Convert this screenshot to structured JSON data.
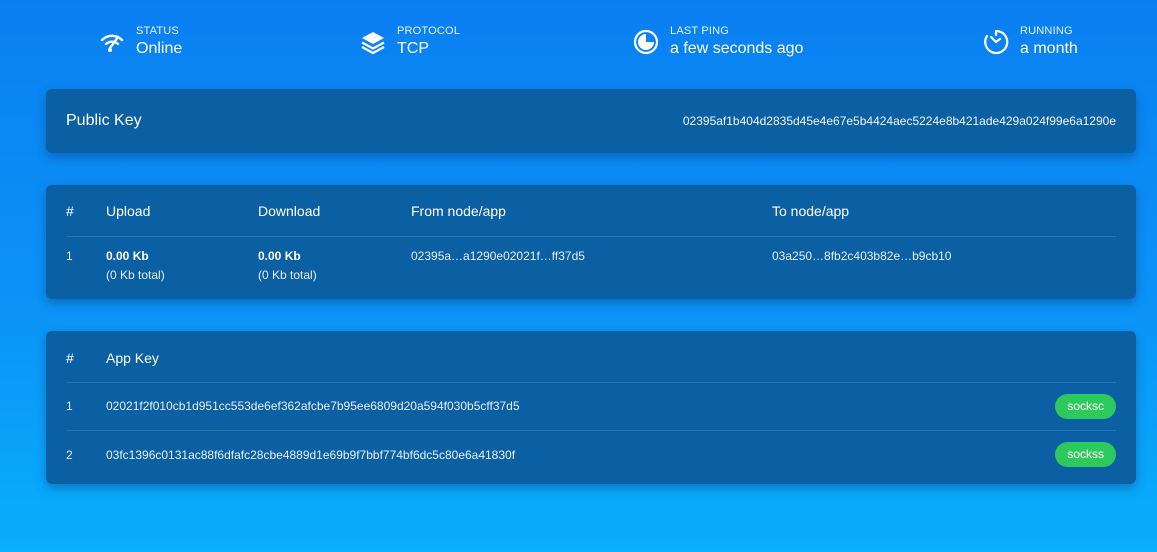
{
  "stats": [
    {
      "label": "STATUS",
      "value": "Online",
      "icon": "wifi-signal-icon"
    },
    {
      "label": "PROTOCOL",
      "value": "TCP",
      "icon": "layers-icon"
    },
    {
      "label": "LAST PING",
      "value": "a few seconds ago",
      "icon": "moon-clock-icon"
    },
    {
      "label": "RUNNING",
      "value": "a month",
      "icon": "timer-icon"
    }
  ],
  "public_key": {
    "label": "Public Key",
    "value": "02395af1b404d2835d45e4e67e5b4424aec5224e8b421ade429a024f99e6a1290e"
  },
  "transports": {
    "headers": [
      "#",
      "Upload",
      "Download",
      "From node/app",
      "To node/app"
    ],
    "rows": [
      {
        "index": "1",
        "upload": "0.00 Kb",
        "upload_total": "(0 Kb total)",
        "download": "0.00 Kb",
        "download_total": "(0 Kb total)",
        "from": "02395a…a1290e02021f…ff37d5",
        "to": "03a250…8fb2c403b82e…b9cb10"
      }
    ]
  },
  "apps": {
    "headers": [
      "#",
      "App Key"
    ],
    "rows": [
      {
        "index": "1",
        "key": "02021f2f010cb1d951cc553de6ef362afcbe7b95ee6809d20a594f030b5cff37d5",
        "badge": "socksc"
      },
      {
        "index": "2",
        "key": "03fc1396c0131ac88f6dfafc28cbe4889d1e69b9f7bbf774bf6dc5c80e6a41830f",
        "badge": "sockss"
      }
    ],
    "badge_color": "#2ec95c"
  }
}
